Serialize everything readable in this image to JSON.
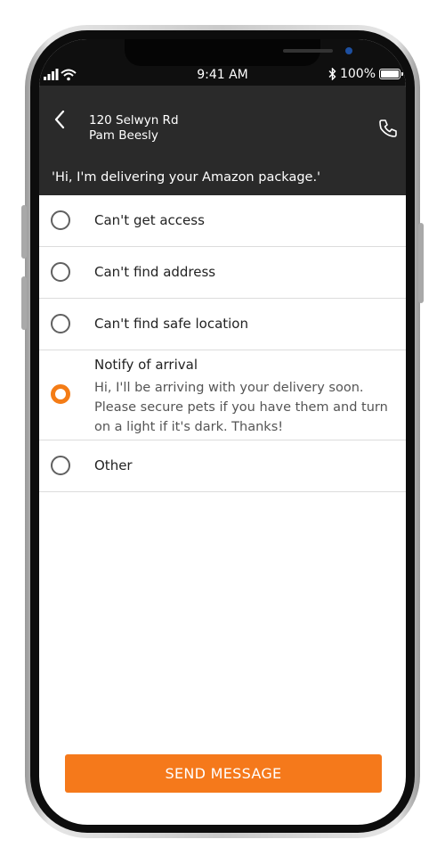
{
  "status_bar": {
    "time": "9:41 AM",
    "battery": "100%"
  },
  "header": {
    "address": "120 Selwyn Rd",
    "customer": "Pam Beesly",
    "quote": "'Hi, I'm delivering your Amazon package.'"
  },
  "options": [
    {
      "label": "Can't get access",
      "selected": false
    },
    {
      "label": "Can't find address",
      "selected": false
    },
    {
      "label": "Can't find safe location",
      "selected": false
    },
    {
      "label": "Notify of arrival",
      "selected": true,
      "description": "Hi, I'll be arriving with your delivery soon. Please secure pets if you have them and turn on a light if it's dark. Thanks!"
    },
    {
      "label": "Other",
      "selected": false
    }
  ],
  "send_label": "SEND MESSAGE",
  "colors": {
    "accent": "#f5791b",
    "header_bg": "#2a2a2a"
  },
  "icons": [
    "back-chevron-icon",
    "phone-call-icon",
    "cellular-signal-icon",
    "wifi-icon",
    "bluetooth-icon",
    "battery-icon"
  ]
}
